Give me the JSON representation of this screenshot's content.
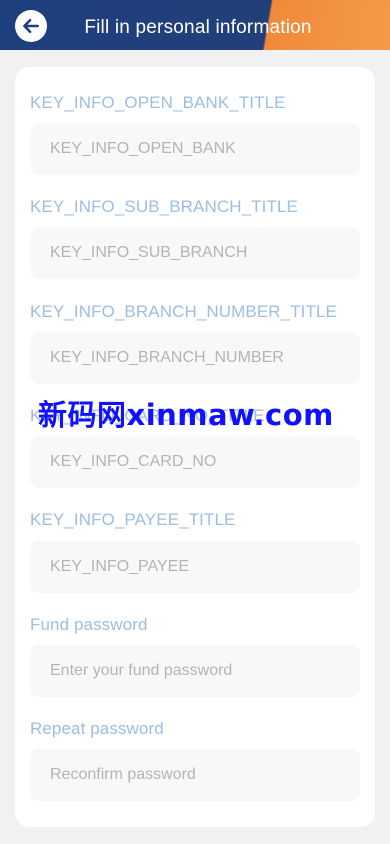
{
  "header": {
    "title": "Fill in personal information",
    "back_icon": "arrow-left-icon",
    "colors": {
      "primary": "#1e3f7e",
      "accent": "#f59a48"
    }
  },
  "form": {
    "fields": [
      {
        "label": "KEY_INFO_OPEN_BANK_TITLE",
        "placeholder": "KEY_INFO_OPEN_BANK",
        "value": ""
      },
      {
        "label": "KEY_INFO_SUB_BRANCH_TITLE",
        "placeholder": "KEY_INFO_SUB_BRANCH",
        "value": ""
      },
      {
        "label": "KEY_INFO_BRANCH_NUMBER_TITLE",
        "placeholder": "KEY_INFO_BRANCH_NUMBER",
        "value": ""
      },
      {
        "label": "KEY_INFO_CARD_NO_TITLE",
        "placeholder": "KEY_INFO_CARD_NO",
        "value": ""
      },
      {
        "label": "KEY_INFO_PAYEE_TITLE",
        "placeholder": "KEY_INFO_PAYEE",
        "value": ""
      },
      {
        "label": "Fund password",
        "placeholder": "Enter your fund password",
        "value": ""
      },
      {
        "label": "Repeat password",
        "placeholder": "Reconfirm password",
        "value": ""
      }
    ]
  },
  "watermark": {
    "text": "新码网xinmaw.com"
  }
}
